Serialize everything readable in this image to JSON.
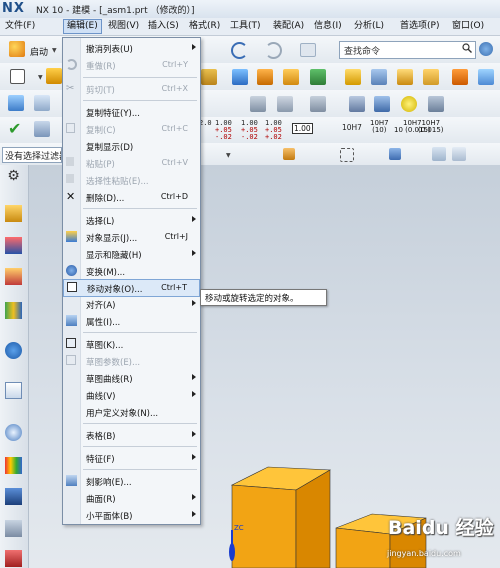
{
  "window": {
    "logo": "NX",
    "title": "NX 10 - 建模 - [_asm1.prt （修改的）]"
  },
  "menubar": {
    "items": [
      {
        "label": "文件(F)"
      },
      {
        "label": "编辑(E)"
      },
      {
        "label": "视图(V)"
      },
      {
        "label": "插入(S)"
      },
      {
        "label": "格式(R)"
      },
      {
        "label": "工具(T)"
      },
      {
        "label": "装配(A)"
      },
      {
        "label": "信息(I)"
      },
      {
        "label": "分析(L)"
      },
      {
        "label": "首选项(P)"
      },
      {
        "label": "窗口(O)"
      }
    ]
  },
  "toolbar": {
    "start_label": "启动",
    "command_search_placeholder": "查找命令",
    "selection_filter_label": "没有选择过滤器"
  },
  "tolerances": [
    {
      "base": "2.0",
      "top": "",
      "bottom": ""
    },
    {
      "base": "1.00",
      "top": "+.05",
      "bottom": "-.02"
    },
    {
      "base": "1.00",
      "top": "+.05",
      "bottom": "-.02"
    },
    {
      "base": "1.00",
      "top": "+.05",
      "bottom": "+.02"
    },
    {
      "base": "1.00",
      "top": "±.05",
      "bottom": ""
    }
  ],
  "tolerance_box": "1.00",
  "fits": [
    {
      "label": "10H7"
    },
    {
      "label": "10H7",
      "sub": "(10)"
    },
    {
      "label": "10H7",
      "sub": "10 (0.015)"
    },
    {
      "label": "10H7",
      "sub": "(0.015)"
    }
  ],
  "edit_menu": {
    "items": [
      {
        "label": "撤消列表(U)",
        "shortcut": "",
        "submenu": true,
        "disabled": false,
        "icon": "undo-list-icon"
      },
      {
        "label": "重做(R)",
        "shortcut": "Ctrl+Y",
        "submenu": false,
        "disabled": true,
        "icon": "redo-icon"
      },
      {
        "label": "剪切(T)",
        "shortcut": "Ctrl+X",
        "submenu": false,
        "disabled": true,
        "icon": "cut-icon"
      },
      {
        "label": "复制特征(Y)...",
        "shortcut": "",
        "submenu": false,
        "disabled": false,
        "icon": ""
      },
      {
        "label": "复制(C)",
        "shortcut": "Ctrl+C",
        "submenu": false,
        "disabled": true,
        "icon": "copy-icon"
      },
      {
        "label": "复制显示(D)",
        "shortcut": "",
        "submenu": false,
        "disabled": false,
        "icon": ""
      },
      {
        "label": "粘贴(P)",
        "shortcut": "Ctrl+V",
        "submenu": false,
        "disabled": true,
        "icon": "paste-icon"
      },
      {
        "label": "选择性粘贴(E)...",
        "shortcut": "",
        "submenu": false,
        "disabled": true,
        "icon": "paste-special-icon"
      },
      {
        "label": "删除(D)...",
        "shortcut": "Ctrl+D",
        "submenu": false,
        "disabled": false,
        "icon": "delete-icon"
      },
      {
        "label": "选择(L)",
        "shortcut": "",
        "submenu": true,
        "disabled": false,
        "icon": ""
      },
      {
        "label": "对象显示(J)...",
        "shortcut": "Ctrl+J",
        "submenu": false,
        "disabled": false,
        "icon": "object-display-icon"
      },
      {
        "label": "显示和隐藏(H)",
        "shortcut": "",
        "submenu": true,
        "disabled": false,
        "icon": ""
      },
      {
        "label": "变换(M)...",
        "shortcut": "",
        "submenu": false,
        "disabled": false,
        "icon": "transform-icon"
      },
      {
        "label": "移动对象(O)...",
        "shortcut": "Ctrl+T",
        "submenu": false,
        "disabled": false,
        "icon": "move-object-icon",
        "highlighted": true
      },
      {
        "label": "对齐(A)",
        "shortcut": "",
        "submenu": true,
        "disabled": false,
        "icon": ""
      },
      {
        "label": "属性(I)...",
        "shortcut": "",
        "submenu": false,
        "disabled": false,
        "icon": "properties-icon"
      },
      {
        "label": "草图(K)...",
        "shortcut": "",
        "submenu": false,
        "disabled": false,
        "icon": "sketch-icon"
      },
      {
        "label": "草图参数(E)...",
        "shortcut": "",
        "submenu": false,
        "disabled": true,
        "icon": "sketch-params-icon"
      },
      {
        "label": "草图曲线(R)",
        "shortcut": "",
        "submenu": true,
        "disabled": false,
        "icon": ""
      },
      {
        "label": "曲线(V)",
        "shortcut": "",
        "submenu": true,
        "disabled": false,
        "icon": ""
      },
      {
        "label": "用户定义对象(N)...",
        "shortcut": "",
        "submenu": false,
        "disabled": false,
        "icon": ""
      },
      {
        "label": "表格(B)",
        "shortcut": "",
        "submenu": true,
        "disabled": false,
        "icon": ""
      },
      {
        "label": "特征(F)",
        "shortcut": "",
        "submenu": true,
        "disabled": false,
        "icon": ""
      },
      {
        "label": "刻影响(E)...",
        "shortcut": "",
        "submenu": false,
        "disabled": false,
        "icon": "engrave-icon"
      },
      {
        "label": "曲面(R)",
        "shortcut": "",
        "submenu": true,
        "disabled": false,
        "icon": ""
      },
      {
        "label": "小平面体(B)",
        "shortcut": "",
        "submenu": true,
        "disabled": false,
        "icon": ""
      }
    ]
  },
  "tooltip": "移动或旋转选定的对象。",
  "watermark": {
    "brand": "Baidu 经验",
    "url": "jingyan.baidu.com"
  },
  "viewport": {
    "axis_label": "ZC"
  },
  "colors": {
    "box": "#f0a818",
    "menu_highlight": "#dce9f8",
    "menubar_active": "#cfe0f5"
  }
}
